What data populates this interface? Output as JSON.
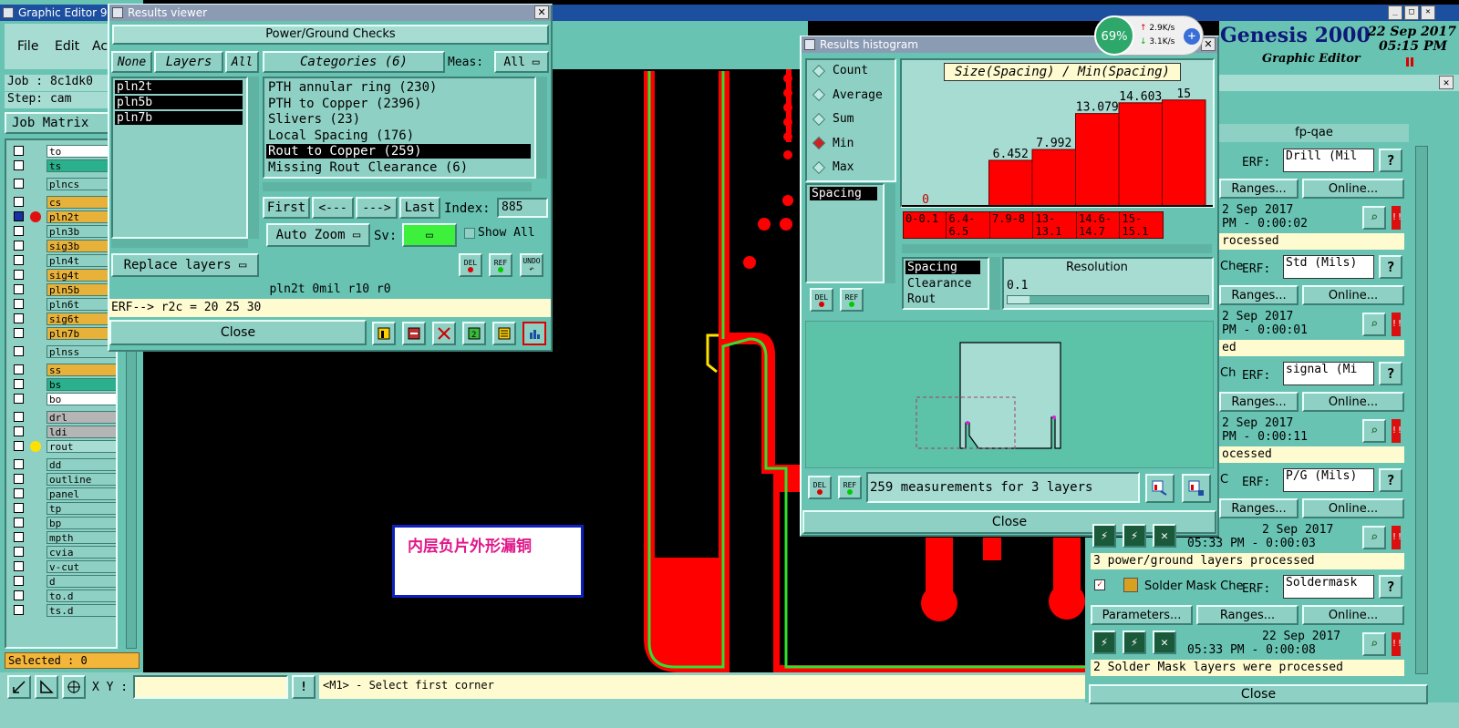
{
  "main_window": {
    "title": "Graphic Editor 9.",
    "menu": [
      "File",
      "Edit",
      "Ac"
    ],
    "job": "Job : 8c1dk0",
    "step": "Step: cam",
    "job_matrix": "Job Matrix",
    "selected": "Selected : 0",
    "xy_label": "X Y :",
    "xy_value": "",
    "status_message": "<M1> - Select first corner",
    "layers": [
      {
        "name": "to",
        "color": "white"
      },
      {
        "name": "ts",
        "color": "green"
      },
      {
        "name": "plncs",
        "color": "teal"
      },
      {
        "name": "cs",
        "color": "orange"
      },
      {
        "name": "pln2t",
        "color": "orange",
        "active": true
      },
      {
        "name": "pln3b",
        "color": "teal"
      },
      {
        "name": "sig3b",
        "color": "orange"
      },
      {
        "name": "pln4t",
        "color": "teal"
      },
      {
        "name": "sig4t",
        "color": "orange"
      },
      {
        "name": "pln5b",
        "color": "orange"
      },
      {
        "name": "pln6t",
        "color": "teal"
      },
      {
        "name": "sig6t",
        "color": "orange"
      },
      {
        "name": "pln7b",
        "color": "orange"
      },
      {
        "name": "plnss",
        "color": "teal"
      },
      {
        "name": "ss",
        "color": "orange"
      },
      {
        "name": "bs",
        "color": "green"
      },
      {
        "name": "bo",
        "color": "white"
      },
      {
        "name": "drl",
        "color": "gray"
      },
      {
        "name": "ldi",
        "color": "gray"
      },
      {
        "name": "rout",
        "color": "pale",
        "yellow_dot": true
      },
      {
        "name": "dd",
        "color": "teal"
      },
      {
        "name": "outline",
        "color": "teal"
      },
      {
        "name": "panel",
        "color": "teal"
      },
      {
        "name": "tp",
        "color": "teal"
      },
      {
        "name": "bp",
        "color": "teal"
      },
      {
        "name": "mpth",
        "color": "teal"
      },
      {
        "name": "cvia",
        "color": "teal"
      },
      {
        "name": "v-cut",
        "color": "teal"
      },
      {
        "name": "d",
        "color": "teal"
      },
      {
        "name": "to.d",
        "color": "teal"
      },
      {
        "name": "ts.d",
        "color": "teal"
      }
    ]
  },
  "results_viewer": {
    "title": "Results viewer",
    "header": "Power/Ground Checks",
    "none_btn": "None",
    "layers_btn": "Layers",
    "all_btn": "All",
    "categories_btn": "Categories (6)",
    "meas_label": "Meas:",
    "meas_value": "All",
    "layer_list": [
      "pln2t",
      "pln5b",
      "pln7b"
    ],
    "categories": [
      "PTH annular ring (230)",
      "PTH to Copper (2396)",
      "Slivers (23)",
      "Local Spacing (176)",
      "Rout to Copper (259)",
      "Missing Rout Clearance (6)"
    ],
    "selected_category": 4,
    "first_btn": "First",
    "prev_btn": "<---",
    "next_btn": "--->",
    "last_btn": "Last",
    "index_label": "Index:",
    "index_value": "885",
    "auto_zoom": "Auto Zoom",
    "sv_label": "Sv:",
    "show_all": "Show All",
    "replace_layers": "Replace layers",
    "del": "DEL",
    "ref": "REF",
    "undo": "UNDO",
    "info_line": "pln2t 0mil  r10  r0",
    "erf_line": "ERF--> r2c = 20 25 30",
    "close": "Close"
  },
  "histogram": {
    "title": "Results histogram",
    "stats": [
      "Count",
      "Average",
      "Sum",
      "Min",
      "Max"
    ],
    "selected_stat": "Min",
    "list_item": "Spacing",
    "chart_title": "Size(Spacing) / Min(Spacing)",
    "bins": [
      "0-0.1",
      "6.4-6.5",
      "7.9-8",
      "13-13.1",
      "14.6-14.7",
      "15-15.1"
    ],
    "value_labels": [
      "0",
      "6.452",
      "7.992",
      "13.079",
      "14.603",
      "15"
    ],
    "measure_types": [
      "Spacing",
      "Clearance",
      "Rout"
    ],
    "resolution_label": "Resolution",
    "resolution_value": "0.1",
    "summary": "259 measurements for 3 layers",
    "del": "DEL",
    "ref": "REF",
    "close": "Close"
  },
  "chart_data": {
    "type": "bar",
    "title": "Size(Spacing) / Min(Spacing)",
    "categories": [
      "0-0.1",
      "6.4-6.5",
      "7.9-8",
      "13-13.1",
      "14.6-14.7",
      "15-15.1"
    ],
    "values": [
      0,
      6.452,
      7.992,
      13.079,
      14.603,
      15
    ],
    "ylim": [
      0,
      16
    ]
  },
  "network": {
    "percent": "69%",
    "up": "2.9K/s",
    "down": "3.1K/s"
  },
  "genesis": {
    "brand": "Genesis 2000",
    "subtitle": "Graphic Editor",
    "date": "22 Sep 2017",
    "time": "05:15 PM"
  },
  "checklist": {
    "header": "fp-qae",
    "erf_label": "ERF:",
    "ranges": "Ranges...",
    "online": "Online...",
    "parameters": "Parameters...",
    "close": "Close",
    "groups": [
      {
        "erf": "Drill (Mil",
        "date": "2 Sep 2017",
        "time": "PM - 0:00:02",
        "status": "rocessed"
      },
      {
        "name": "Che",
        "erf": "Std (Mils)",
        "date": "2 Sep 2017",
        "time": "PM - 0:00:01",
        "status": "ed"
      },
      {
        "name": "Ch",
        "erf": "signal (Mi",
        "date": "2 Sep 2017",
        "time": "PM - 0:00:11",
        "status": "ocessed"
      },
      {
        "name": "C",
        "erf": "P/G (Mils)",
        "date": "2 Sep 2017",
        "time": "05:33 PM - 0:00:03",
        "status": "3 power/ground layers processed"
      },
      {
        "name": "Solder Mask Che",
        "erf": "Soldermask",
        "date": "22 Sep 2017",
        "time": "05:33 PM - 0:00:08",
        "status": "2 Solder Mask layers were processed"
      }
    ]
  },
  "annotation": {
    "text": "内层负片外形漏铜"
  }
}
